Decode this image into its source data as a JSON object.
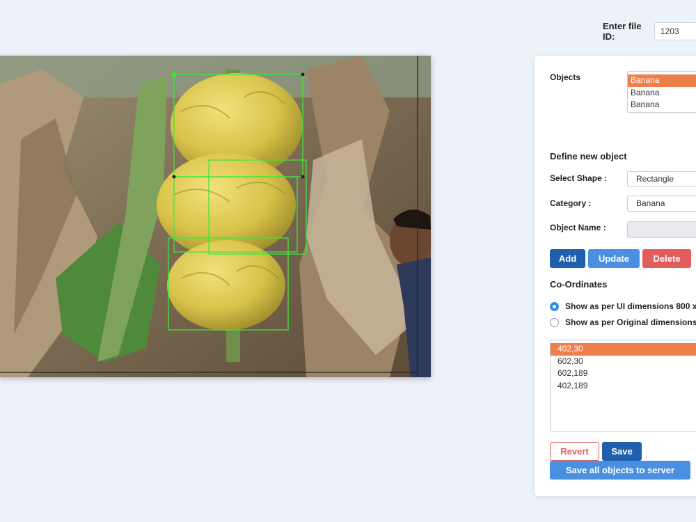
{
  "file_id": {
    "label": "Enter file ID:",
    "value": "1203"
  },
  "objects": {
    "label": "Objects",
    "items": [
      "Banana",
      "Banana",
      "Banana"
    ],
    "selected_index": 0
  },
  "define": {
    "heading": "Define new object",
    "shape_label": "Select Shape :",
    "shape_value": "Rectangle",
    "category_label": "Category :",
    "category_value": "Banana",
    "name_label": "Object Name :",
    "name_value": ""
  },
  "actions": {
    "add": "Add",
    "update": "Update",
    "delete": "Delete"
  },
  "coordinates": {
    "heading": "Co-Ordinates",
    "option_ui": "Show as per UI dimensions 800 x",
    "option_original": "Show as per Original dimensions",
    "selected_option": "ui",
    "points": [
      "402,30",
      "602,30",
      "602,189",
      "402,189"
    ],
    "selected_index": 0
  },
  "footer": {
    "revert": "Revert",
    "save": "Save",
    "save_all": "Save all objects to server"
  },
  "colors": {
    "accent_orange": "#ef7f4a",
    "primary_blue": "#1f5fad",
    "light_blue": "#4a90e2",
    "danger_red": "#e25c5c",
    "box_green": "#3ee63e"
  }
}
